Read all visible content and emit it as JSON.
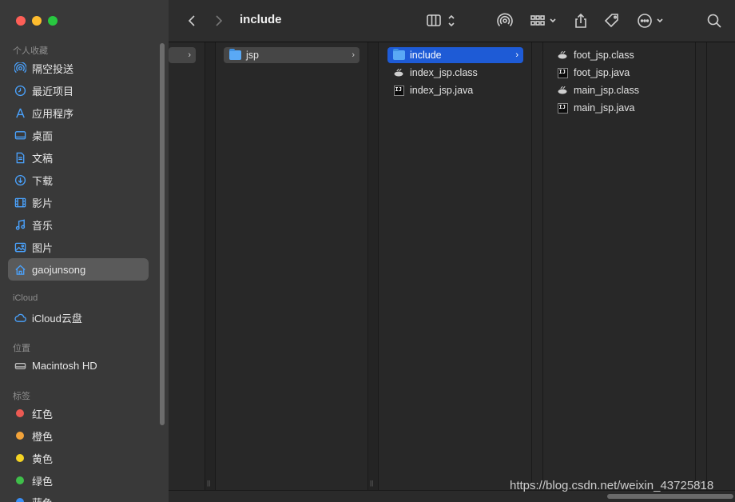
{
  "toolbar": {
    "title": "include"
  },
  "sidebar": {
    "favorites_header": "个人收藏",
    "favorites": [
      {
        "label": "隔空投送",
        "icon": "airdrop-icon"
      },
      {
        "label": "最近项目",
        "icon": "clock-icon"
      },
      {
        "label": "应用程序",
        "icon": "applications-icon"
      },
      {
        "label": "桌面",
        "icon": "desktop-icon"
      },
      {
        "label": "文稿",
        "icon": "document-icon"
      },
      {
        "label": "下载",
        "icon": "download-icon"
      },
      {
        "label": "影片",
        "icon": "film-icon"
      },
      {
        "label": "音乐",
        "icon": "music-icon"
      },
      {
        "label": "图片",
        "icon": "photo-icon"
      },
      {
        "label": "gaojunsong",
        "icon": "home-icon",
        "selected": true
      }
    ],
    "icloud_header": "iCloud",
    "icloud": [
      {
        "label": "iCloud云盘",
        "icon": "cloud-icon"
      }
    ],
    "locations_header": "位置",
    "locations": [
      {
        "label": "Macintosh HD",
        "icon": "disk-icon"
      }
    ],
    "tags_header": "标签",
    "tags": [
      {
        "label": "红色",
        "color": "#ec5a53"
      },
      {
        "label": "橙色",
        "color": "#f2a33a"
      },
      {
        "label": "黄色",
        "color": "#f5d423"
      },
      {
        "label": "绿色",
        "color": "#3fbf4a"
      },
      {
        "label": "蓝色",
        "color": "#3a8ef5"
      }
    ]
  },
  "columns": {
    "col2": [
      {
        "label": "jsp",
        "type": "folder",
        "selected": "inactive"
      }
    ],
    "col3": [
      {
        "label": "include",
        "type": "folder",
        "selected": "active"
      },
      {
        "label": "index_jsp.class",
        "type": "class"
      },
      {
        "label": "index_jsp.java",
        "type": "java"
      }
    ],
    "col4": [
      {
        "label": "foot_jsp.class",
        "type": "class"
      },
      {
        "label": "foot_jsp.java",
        "type": "java"
      },
      {
        "label": "main_jsp.class",
        "type": "class"
      },
      {
        "label": "main_jsp.java",
        "type": "java"
      }
    ]
  },
  "watermark": "https://blog.csdn.net/weixin_43725818"
}
